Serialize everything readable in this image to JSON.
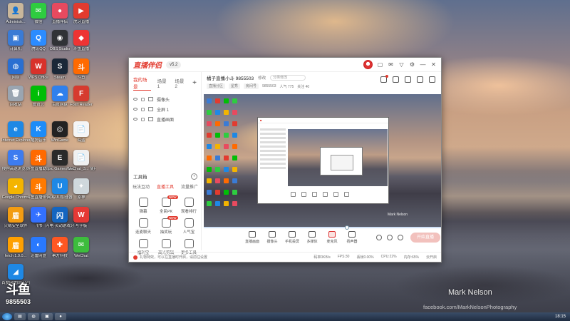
{
  "desktop": {
    "icons": [
      {
        "label": "Administr...",
        "color": "#c9b79b",
        "glyph": "👤"
      },
      {
        "label": "微信",
        "color": "#2ecc40",
        "glyph": "✉"
      },
      {
        "label": "直播伴侣",
        "color": "#e84a5f",
        "glyph": "●"
      },
      {
        "label": "虎牙直播",
        "color": "#e23b2f",
        "glyph": "▶"
      },
      {
        "label": "计算机",
        "color": "#3a7bd5",
        "glyph": "▣"
      },
      {
        "label": "腾讯QQ",
        "color": "#2b8cff",
        "glyph": "Q"
      },
      {
        "label": "OBS Studio",
        "color": "#303236",
        "glyph": "◉"
      },
      {
        "label": "斗鱼直播",
        "color": "#e33",
        "glyph": "◆"
      },
      {
        "label": "网络",
        "color": "#2a6fd1",
        "glyph": "◍"
      },
      {
        "label": "WPS Office",
        "color": "#d8322b",
        "glyph": "W"
      },
      {
        "label": "Steam",
        "color": "#1b2838",
        "glyph": "S"
      },
      {
        "label": "斗鱼",
        "color": "#ff6a00",
        "glyph": "斗"
      },
      {
        "label": "回收站",
        "color": "#9aa5b1",
        "glyph": "🗑"
      },
      {
        "label": "爱奇艺",
        "color": "#00be06",
        "glyph": "i"
      },
      {
        "label": "百度网盘",
        "color": "#2f80ed",
        "glyph": "☁"
      },
      {
        "label": "Foxit Reader",
        "color": "#d63b2f",
        "glyph": "F"
      },
      {
        "label": "Internet Explorer",
        "color": "#1e88e5",
        "glyph": "e"
      },
      {
        "label": "酷狗音乐",
        "color": "#1d8cf8",
        "glyph": "K"
      },
      {
        "label": "WinGame",
        "color": "#222",
        "glyph": "◎"
      },
      {
        "label": "海盗",
        "color": "#f5f5f5",
        "glyph": "📄"
      },
      {
        "label": "搜狗高速浏览器",
        "color": "#3d7cf0",
        "glyph": "S"
      },
      {
        "label": "斗鱼直播助手",
        "color": "#ff6a00",
        "glyph": "斗"
      },
      {
        "label": "Epic Games Launcher",
        "color": "#2a2a2a",
        "glyph": "E"
      },
      {
        "label": "WeChat_3... 使用说明",
        "color": "#f0f0f0",
        "glyph": "📄"
      },
      {
        "label": "Google Chrome",
        "color": "#f4b400",
        "glyph": "◕"
      },
      {
        "label": "斗鱼直播伴侣",
        "color": "#ff7a00",
        "glyph": "斗"
      },
      {
        "label": "网易UU加速器",
        "color": "#1e88e5",
        "glyph": "U"
      },
      {
        "label": "原神",
        "color": "#cfd8dc",
        "glyph": "✦"
      },
      {
        "label": "火绒安全软件",
        "color": "#f39c12",
        "glyph": "盾"
      },
      {
        "label": "飞书",
        "color": "#3370ff",
        "glyph": "✈"
      },
      {
        "label": "闪电·灵动游戏分屏",
        "color": "#1565c0",
        "glyph": "闪"
      },
      {
        "label": "写字板",
        "color": "#e53935",
        "glyph": "W"
      },
      {
        "label": "fetch 1.0.0...",
        "color": "#ffa000",
        "glyph": "盾"
      },
      {
        "label": "迅雷网盘",
        "color": "#2979ff",
        "glyph": "◐"
      },
      {
        "label": "幂方科技",
        "color": "#ff5722",
        "glyph": "✚"
      },
      {
        "label": "WeChat",
        "color": "#3dbd3d",
        "glyph": "✉"
      },
      {
        "label": "百度网盘同步空间",
        "color": "#1e88e5",
        "glyph": "◢"
      }
    ],
    "logo_badge": {
      "mark": "斗鱼",
      "number": "9855503"
    },
    "watermark": "Mark Nelson",
    "watermark_url": "facebook.com/MarkNelsonPhotography"
  },
  "taskbar": {
    "clock": "18:15"
  },
  "app": {
    "logo": "直播伴侣",
    "version": "v5.2",
    "title_buttons": [
      "skin-icon",
      "message-icon",
      "vip-icon",
      "settings-icon",
      "minimize-icon",
      "close-icon"
    ],
    "scene_tabs": [
      "我的场景",
      "场景1",
      "场景2"
    ],
    "sources": [
      "摄像头",
      "全屏 1",
      "直播画面"
    ],
    "tools_title": "工具箱",
    "tool_tabs": [
      "玩法互动",
      "直播工具",
      "流量推广"
    ],
    "tools": [
      {
        "label": "弹幕",
        "new": false
      },
      {
        "label": "全民PK",
        "new": true
      },
      {
        "label": "观看排行",
        "new": false
      },
      {
        "label": "连麦聊天",
        "new": false
      },
      {
        "label": "抽奖玩",
        "new": true
      },
      {
        "label": "人气宝",
        "new": false
      },
      {
        "label": "福利宝",
        "new": false
      },
      {
        "label": "高光剪辑",
        "new": false
      },
      {
        "label": "更多工具",
        "new": false
      }
    ],
    "room": {
      "title": "橘子直播小斗 9855503",
      "tag": "修改",
      "edit_placeholder": "分类修改",
      "chips": [
        "直播分区",
        "星秀",
        "房间号",
        "9855503",
        "人气 775",
        "关注 40"
      ]
    },
    "preview_signature": "Mark Nelson",
    "bottom_tools": [
      {
        "label": "直播画面",
        "red": false
      },
      {
        "label": "摄像头",
        "red": false
      },
      {
        "label": "手机投屏",
        "red": false
      },
      {
        "label": "多媒体",
        "red": false
      },
      {
        "label": "麦克风",
        "red": true
      },
      {
        "label": "扬声器",
        "red": false
      }
    ],
    "start_live": "开始直播",
    "status": {
      "notice": "礼物特效，可以在直播时开启，请前往设置",
      "stats": [
        "码率0KB/s",
        "FPS:30",
        "丢帧0.00%",
        "CPU:22%",
        "内存:65%",
        "云开启"
      ]
    }
  }
}
